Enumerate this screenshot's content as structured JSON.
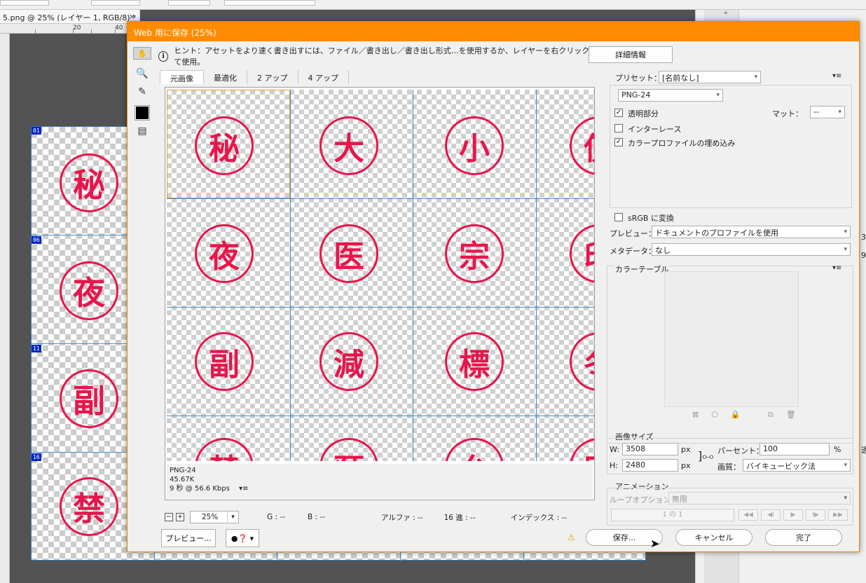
{
  "app": {
    "doc_tab": "5.png @ 25% (レイヤー 1, RGB/8) *",
    "doc_tab_close": "×",
    "ruler_ticks": [
      "20",
      "40"
    ],
    "right_panel_collapse": "«",
    "right_edge_labels": [
      "3.",
      "9",
      "透"
    ]
  },
  "background_canvas": {
    "slice_badges": [
      "01",
      "06",
      "11",
      "16"
    ],
    "stamps": [
      "秘",
      "夜",
      "副",
      "禁"
    ]
  },
  "dialog": {
    "title": "Web 用に保存 (25%)",
    "hint": "ヒント：アセットをより速く書き出すには、ファイル／書き出し／書き出し形式…を使用するか、レイヤーを右クリックして使用。",
    "details_button": "詳細情報",
    "tools": [
      "hand-icon",
      "slice-select-icon",
      "zoom-icon",
      "eyedropper-icon",
      "color-swatch",
      "slice-visibility-icon"
    ],
    "tabs": [
      "元画像",
      "最適化",
      "2 アップ",
      "4 アップ"
    ],
    "active_tab": "元画像",
    "preview_stamps": [
      [
        "秘",
        "大",
        "小",
        "使"
      ],
      [
        "夜",
        "医",
        "宗",
        "印"
      ],
      [
        "副",
        "減",
        "標",
        "冬"
      ],
      [
        "禁",
        "預",
        "允",
        "円"
      ]
    ],
    "preview_info": {
      "format": "PNG-24",
      "size": "45.67K",
      "speed": "9 秒 @ 56.6 Kbps",
      "menu": "▾≡"
    },
    "status": {
      "zoom": "25%",
      "g": "G : --",
      "b": "B : --",
      "alpha": "アルファ : --",
      "hex": "16 進 : --",
      "index": "インデックス : --"
    },
    "settings": {
      "preset_label": "プリセット：",
      "preset_value": "[名前なし]",
      "format": "PNG-24",
      "transparency_label": "透明部分",
      "transparency_checked": true,
      "matte_label": "マット：",
      "matte_value": "--",
      "interlace_label": "インターレース",
      "interlace_checked": false,
      "embed_profile_label": "カラープロファイルの埋め込み",
      "embed_profile_checked": true,
      "srgb_label": "sRGB に変換",
      "srgb_checked": false,
      "preview_label": "プレビュー：",
      "preview_value": "ドキュメントのプロファイルを使用",
      "metadata_label": "メタデータ：",
      "metadata_value": "なし"
    },
    "color_table": {
      "label": "カラーテーブル"
    },
    "image_size": {
      "label": "画像サイズ",
      "w_label": "W:",
      "w_value": "3508",
      "w_unit": "px",
      "h_label": "H:",
      "h_value": "2480",
      "h_unit": "px",
      "percent_label": "パーセント：",
      "percent_value": "100",
      "percent_unit": "%",
      "quality_label": "画質：",
      "quality_value": "バイキュービック法"
    },
    "animation": {
      "label": "アニメーション",
      "loop_label": "ループオプション：",
      "loop_value": "無限",
      "frame_counter": "1 の 1"
    },
    "footer": {
      "preview_button": "プレビュー...",
      "save_button": "保存...",
      "cancel_button": "キャンセル",
      "done_button": "完了"
    }
  },
  "colors": {
    "dialog_title_bar": "#ff8c00",
    "stamp_red": "#e8154b",
    "slice_line_blue": "#3f8fd8",
    "slice_badge_blue": "#0026c7"
  }
}
